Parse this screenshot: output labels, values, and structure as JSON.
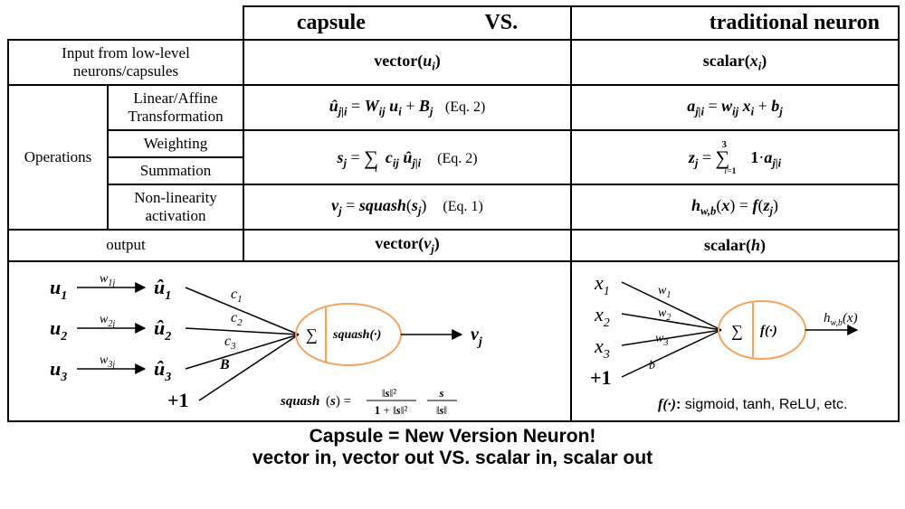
{
  "header": {
    "capsule": "capsule",
    "vs": "VS.",
    "neuron": "traditional neuron"
  },
  "rows": {
    "input": {
      "label": "Input from low-level\nneurons/capsules",
      "cap": "vector(uᵢ)",
      "neu": "scalar(xᵢ)"
    },
    "ops_label": "Operations",
    "affine": {
      "label": "Linear/Affine\nTransformation",
      "cap": "ûⱼ|ᵢ = Wᵢⱼ uᵢ + Bⱼ",
      "cap_ref": "(Eq. 2)",
      "neu": "aⱼ|ᵢ = wᵢⱼ xᵢ + bⱼ"
    },
    "weighting": {
      "label": "Weighting"
    },
    "summation": {
      "label": "Summation"
    },
    "ws_cap": "sⱼ = ∑ᵢ cᵢⱼ ûⱼ|ᵢ",
    "ws_cap_ref": "(Eq. 2)",
    "ws_neu": "zⱼ = ∑ 1·aⱼ|ᵢ",
    "ws_neu_limits": "i=1..3",
    "nonlin": {
      "label": "Non-linearity\nactivation",
      "cap": "vⱼ = squash(sⱼ)",
      "cap_ref": "(Eq. 1)",
      "neu": "h_w,b(x) = f(zⱼ)"
    },
    "output": {
      "label": "output",
      "cap": "vector(vⱼ)",
      "neu": "scalar(h)"
    }
  },
  "diag_left": {
    "inputs": [
      "u₁",
      "u₂",
      "u₃"
    ],
    "weights": [
      "w₁ⱼ",
      "w₂ⱼ",
      "w₃ⱼ"
    ],
    "uhat": [
      "û₁",
      "û₂",
      "û₃"
    ],
    "coeffs": [
      "c₁",
      "c₂",
      "c₃",
      "B"
    ],
    "bias": "+1",
    "sigma": "Σ",
    "act": "squash(·)",
    "out": "vⱼ",
    "squash_eq": "squash(s) = (‖s‖² / (1 + ‖s‖²)) · (s / ‖s‖)"
  },
  "diag_right": {
    "inputs": [
      "x₁",
      "x₂",
      "x₃"
    ],
    "weights": [
      "w₁",
      "w₂",
      "w₃",
      "b"
    ],
    "bias": "+1",
    "sigma": "Σ",
    "act": "f(·)",
    "out": "h_w,b(x)",
    "note": "f(·): sigmoid, tanh, ReLU, etc."
  },
  "caption": {
    "line1": "Capsule = New Version Neuron!",
    "line2": "vector in, vector out  VS.  scalar in, scalar out"
  }
}
